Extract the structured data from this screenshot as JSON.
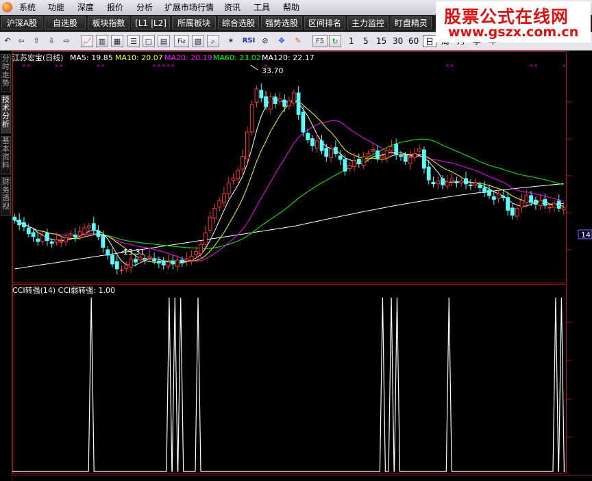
{
  "menu": {
    "items": [
      "系统",
      "功能",
      "深度",
      "报价",
      "分析",
      "扩展市场行情",
      "资讯",
      "工具",
      "帮助"
    ]
  },
  "navbar": {
    "buttons": [
      "沪深A股",
      "自选股",
      "板块指数",
      "[L1 |L2]",
      "所属板块",
      "综合选股",
      "强势选股",
      "区间排名",
      "主力监控",
      "盯盘精灵"
    ]
  },
  "toolbar": {
    "periods": [
      "1",
      "5",
      "15",
      "30",
      "60"
    ],
    "period_tabs": [
      "日",
      "周",
      "月",
      "季",
      "年"
    ],
    "selected_period": "日",
    "rsi_label": "RSI",
    "f5_label": "F5",
    "fiz_label": "Fiz"
  },
  "watermark": {
    "line1": "股票公式在线网",
    "line2": "www.gszx.com.cn"
  },
  "side_tabs": [
    "分时走势",
    "技术分析",
    "基本资料",
    "财务透视"
  ],
  "main_chart": {
    "stock_title": "江苏宏宝(日线)",
    "ma_labels": [
      {
        "text": "MA5: 19.85",
        "color": "#ffffff"
      },
      {
        "text": "MA10: 20.07",
        "color": "#ffff00"
      },
      {
        "text": "MA20: 20.19",
        "color": "#ff00ff"
      },
      {
        "text": "MA60: 23.02",
        "color": "#00ff00"
      },
      {
        "text": "MA120: 22.17",
        "color": "#ffffff"
      }
    ],
    "high_label": "33.70",
    "low_label": "13.31",
    "right_axis_marker": "14"
  },
  "cci_panel": {
    "title": "CCI转强(14) CCI弱转强: 1.00"
  },
  "colors": {
    "up": "#ff3232",
    "down": "#54ffff",
    "frame": "#b01515",
    "ma5": "#ffffff",
    "ma10": "#ffff00",
    "ma20": "#ff00ff",
    "ma60": "#00ff00",
    "ma120": "#ffffff",
    "signal": "#ffffff",
    "markers": "#ff00ff"
  },
  "chart_data": {
    "type": "line",
    "title": "江苏宏宝(日线)",
    "price_range": [
      13.31,
      33.7
    ],
    "ma_values": {
      "MA5": 19.85,
      "MA10": 20.07,
      "MA20": 20.19,
      "MA60": 23.02,
      "MA120": 22.17
    },
    "close_series": [
      18.6,
      18.1,
      17.9,
      17.2,
      16.9,
      16.4,
      17.0,
      16.5,
      16.2,
      16.6,
      16.4,
      16.8,
      17.2,
      16.9,
      17.4,
      17.8,
      18.0,
      17.6,
      16.9,
      15.8,
      15.0,
      14.1,
      13.6,
      13.5,
      14.0,
      14.6,
      14.3,
      14.8,
      14.6,
      14.9,
      14.4,
      14.2,
      14.0,
      14.3,
      14.1,
      14.5,
      14.2,
      14.6,
      14.9,
      15.4,
      16.1,
      17.3,
      18.9,
      19.8,
      20.6,
      21.3,
      22.4,
      22.9,
      23.7,
      25.1,
      27.6,
      30.4,
      32.0,
      31.1,
      30.2,
      31.2,
      30.5,
      31.0,
      30.2,
      30.8,
      31.6,
      29.4,
      27.6,
      26.8,
      26.2,
      26.7,
      25.7,
      25.1,
      25.9,
      25.4,
      24.8,
      23.6,
      24.2,
      24.7,
      24.4,
      25.1,
      25.4,
      25.8,
      24.9,
      25.2,
      25.7,
      26.1,
      25.3,
      25.1,
      24.6,
      25.0,
      25.4,
      25.9,
      23.9,
      22.7,
      22.3,
      22.6,
      22.2,
      22.5,
      22.8,
      22.4,
      22.6,
      22.3,
      22.1,
      22.4,
      21.9,
      21.4,
      21.1,
      20.7,
      21.3,
      20.9,
      19.6,
      19.1,
      19.8,
      20.6,
      21.1,
      20.4,
      20.2,
      20.6,
      20.1,
      19.9,
      20.3,
      19.8,
      19.85
    ],
    "cci_signal_bars": [
      25,
      52,
      54,
      56,
      62,
      126,
      129,
      131,
      149,
      186,
      188,
      190,
      196
    ]
  }
}
